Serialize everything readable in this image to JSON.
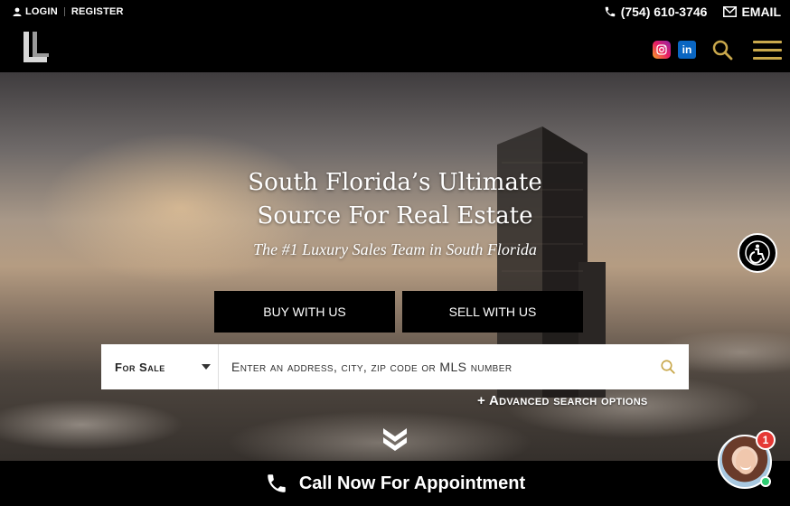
{
  "header": {
    "login_label": "LOGIN",
    "register_label": "REGISTER",
    "phone": "(754) 610-3746",
    "email_label": "EMAIL",
    "logo_text": "LUXURY LIFE"
  },
  "hero": {
    "title_line1": "South Florida’s Ultimate",
    "title_line2": "Source For Real Estate",
    "subtitle": "The #1 Luxury Sales Team in South Florida",
    "buy_button": "BUY WITH US",
    "sell_button": "SELL WITH US"
  },
  "search": {
    "type_selected": "For Sale",
    "placeholder": "Enter an address, city, zip code or MLS number",
    "advanced_label": "+ Advanced search options"
  },
  "callbar": {
    "label": "Call Now For Appointment"
  },
  "chat": {
    "badge_count": "1"
  },
  "colors": {
    "accent_gold": "#c9a84c",
    "bar_black": "#000000",
    "badge_red": "#e53935",
    "online_green": "#2ecc71"
  },
  "icons": [
    "user-icon",
    "phone-icon",
    "mail-icon",
    "instagram-icon",
    "linkedin-icon",
    "search-icon",
    "hamburger-menu-icon",
    "accessibility-icon",
    "double-chevron-down-icon"
  ]
}
